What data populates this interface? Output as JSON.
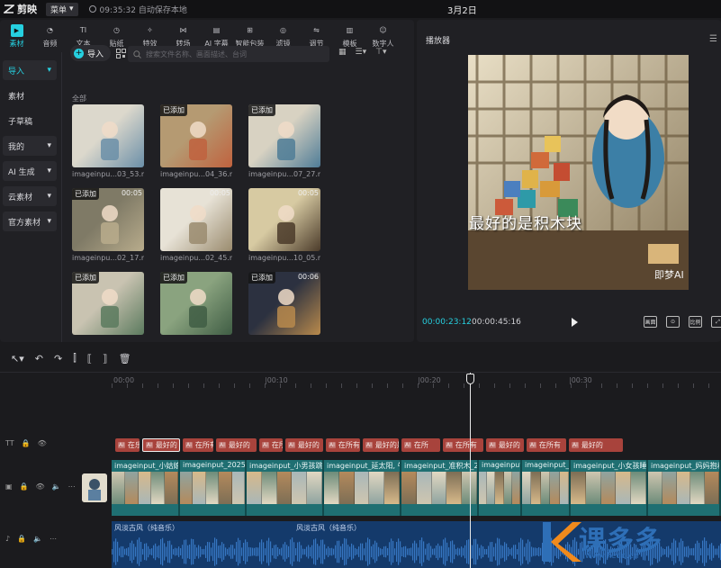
{
  "titlebar": {
    "app_name": "剪映",
    "menu_label": "菜单",
    "autosave_text": "09:35:32 自动保存本地",
    "project_title": "3月2日"
  },
  "toolbar": {
    "items": [
      {
        "label": "素材",
        "icon": "media-icon"
      },
      {
        "label": "音频",
        "icon": "audio-icon"
      },
      {
        "label": "文本",
        "icon": "text-icon"
      },
      {
        "label": "贴纸",
        "icon": "sticker-icon"
      },
      {
        "label": "特效",
        "icon": "effects-icon"
      },
      {
        "label": "转场",
        "icon": "transition-icon"
      },
      {
        "label": "AI 字幕",
        "icon": "subtitle-icon"
      },
      {
        "label": "智能包装",
        "icon": "smart-pack-icon"
      },
      {
        "label": "滤镜",
        "icon": "filter-icon"
      },
      {
        "label": "调节",
        "icon": "adjust-icon"
      },
      {
        "label": "模板",
        "icon": "template-icon"
      },
      {
        "label": "数字人",
        "icon": "avatar-icon"
      }
    ],
    "active_color": "#26d0e0"
  },
  "sidebar": {
    "items": [
      {
        "label": "导入",
        "chevron": "▾"
      },
      {
        "label": "素材",
        "chevron": ""
      },
      {
        "label": "子草稿",
        "chevron": ""
      },
      {
        "label": "我的",
        "chevron": "▾"
      },
      {
        "label": "AI 生成",
        "chevron": "▾"
      },
      {
        "label": "云素材",
        "chevron": "▾"
      },
      {
        "label": "官方素材",
        "chevron": "▾"
      }
    ]
  },
  "media": {
    "import_label": "导入",
    "search_placeholder": "搜索文件名称、画面描述、台词",
    "section_label": "全部",
    "items": [
      {
        "name": "imageinpu...03_53.mp4",
        "badge": "",
        "duration": "",
        "colors": [
          "#dcd8cc",
          "#6b8fa8"
        ]
      },
      {
        "name": "imageinpu...04_36.mp4",
        "badge": "已添加",
        "duration": "",
        "colors": [
          "#b59a72",
          "#c0623e"
        ]
      },
      {
        "name": "imageinpu...07_27.mp4",
        "badge": "已添加",
        "duration": "",
        "colors": [
          "#d8d2c2",
          "#4f7c97"
        ]
      },
      {
        "name": "imageinpu...02_17.mp4",
        "badge": "已添加",
        "duration": "00:05",
        "colors": [
          "#7f7a66",
          "#b8ac8c"
        ]
      },
      {
        "name": "imageinpu...02_45.mp4",
        "badge": "",
        "duration": "00:05",
        "colors": [
          "#e7e2d6",
          "#9a8b6e"
        ]
      },
      {
        "name": "imageinpu...10_05.mp4",
        "badge": "",
        "duration": "00:05",
        "colors": [
          "#d7caa2",
          "#4b3b2a"
        ]
      },
      {
        "name": "",
        "badge": "已添加",
        "duration": "",
        "colors": [
          "#c9c3b1",
          "#5b7a5e"
        ]
      },
      {
        "name": "",
        "badge": "已添加",
        "duration": "",
        "colors": [
          "#8aa37f",
          "#3f5d44"
        ]
      },
      {
        "name": "",
        "badge": "已添加",
        "duration": "00:06",
        "colors": [
          "#2c3140",
          "#b98a4c"
        ]
      }
    ]
  },
  "player": {
    "title": "播放器",
    "caption": "最好的是积木块",
    "logo_text": "即梦AI",
    "current_time": "00:00:23:12",
    "total_time": "00:00:45:16",
    "ctrl_labels": [
      "画面",
      "",
      "比例",
      ""
    ]
  },
  "timeline": {
    "ruler_labels": [
      "00:00",
      "|00:10",
      "|00:20",
      "|00:30"
    ],
    "text_clips": [
      {
        "label": "在乐"
      },
      {
        "label": "最好的"
      },
      {
        "label": "在所有"
      },
      {
        "label": "最好的"
      },
      {
        "label": "在所有"
      },
      {
        "label": "最好的"
      },
      {
        "label": "在所有"
      },
      {
        "label": "最好的是"
      },
      {
        "label": "在所"
      },
      {
        "label": "在所有"
      },
      {
        "label": "最好的"
      },
      {
        "label": "在所有"
      },
      {
        "label": "最好的"
      }
    ],
    "video_clips": [
      {
        "label": "imageinput_小姑娘演"
      },
      {
        "label": "imageinput_2025-0"
      },
      {
        "label": "imageinput_小男孩跳下"
      },
      {
        "label": "imageinput_延太阳, 牛4"
      },
      {
        "label": "imageinput_准积木_202"
      },
      {
        "label": "imageinput_"
      },
      {
        "label": "imageinput_"
      },
      {
        "label": "imageinput_小女孩睡在"
      },
      {
        "label": "imageinput_妈妈抱着男"
      }
    ],
    "audio_clips": [
      {
        "label": "风淡古风（纯音乐）"
      },
      {
        "label": "风淡古风（纯音乐）"
      }
    ]
  },
  "watermark": {
    "text": "课多多",
    "url": "www.kedd.cn"
  }
}
